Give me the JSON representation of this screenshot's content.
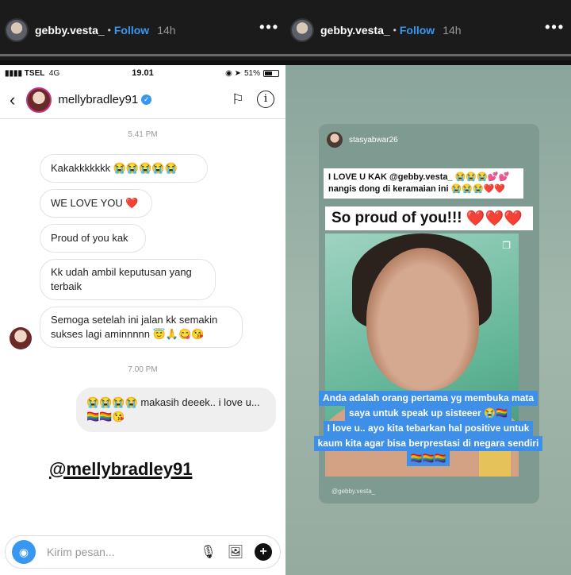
{
  "stories": [
    {
      "username": "gebby.vesta_",
      "separator": "•",
      "follow_label": "Follow",
      "time": "14h",
      "more": "•••"
    },
    {
      "username": "gebby.vesta_",
      "separator": "•",
      "follow_label": "Follow",
      "time": "14h",
      "more": "•••"
    }
  ],
  "left": {
    "statusbar": {
      "carrier": "TSEL",
      "network": "4G",
      "time": "19.01",
      "battery": "51%"
    },
    "dm": {
      "name": "mellybradley91",
      "verified": "✓"
    },
    "timestamps": [
      "5.41 PM",
      "7.00 PM"
    ],
    "messages": [
      "Kakakkkkkkk 😭😭😭😭😭",
      "WE LOVE YOU ❤️",
      "Proud of you kak",
      "Kk udah ambil keputusan yang terbaik",
      "Semoga setelah ini jalan kk semakin sukses lagi aminnnnn 😇🙏😋😘",
      "😭😭😭😭 makasih deeek.. i love u... 🏳️‍🌈🏳️‍🌈😘"
    ],
    "mention": "@mellybradley91",
    "composer": {
      "placeholder": "Kirim pesan..."
    }
  },
  "right": {
    "inner_user": "stasyabwar26",
    "text_box": "I LOVE U KAK @gebby.vesta_ 😭😭😭💕💕 nangis dong di keramaian ini 😭😭😭❤️❤️",
    "proud": "So proud of you!!!",
    "proud_hearts": "❤️❤️❤️",
    "caption_lines": [
      "Anda adalah orang pertama yg membuka mata",
      "saya untuk speak up sisteeer 😭🏳️‍🌈",
      "I love u.. ayo kita tebarkan hal positive untuk",
      "kaum kita agar bisa berprestasi di negara sendiri",
      "🏳️‍🌈🏳️‍🌈🏳️‍🌈"
    ],
    "watermark": "@gebby.vesta_"
  }
}
